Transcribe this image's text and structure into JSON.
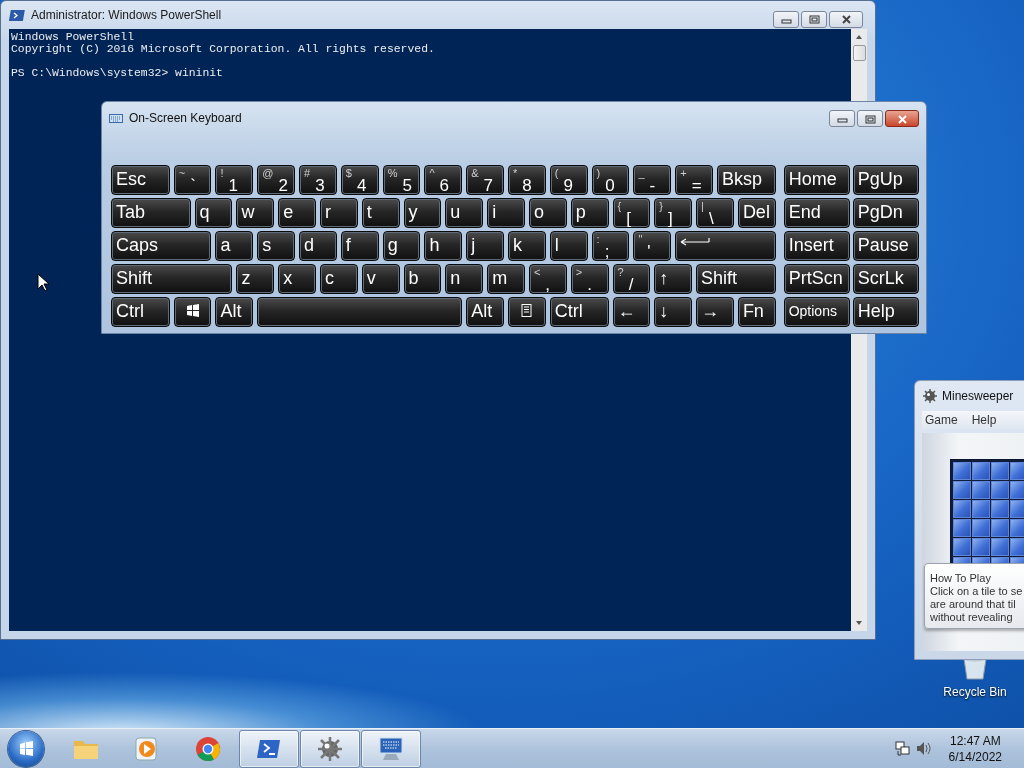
{
  "powershell": {
    "title": "Administrator: Windows PowerShell",
    "lines": [
      "Windows PowerShell",
      "Copyright (C) 2016 Microsoft Corporation. All rights reserved."
    ],
    "prompt": "PS C:\\Windows\\system32> wininit"
  },
  "keyboard": {
    "title": "On-Screen Keyboard",
    "key_rows": [
      {
        "keys": [
          {
            "kind": "label",
            "label": "Esc"
          },
          {
            "kind": "dual",
            "shift": "~",
            "label": "`"
          },
          {
            "kind": "dual",
            "shift": "!",
            "label": "1"
          },
          {
            "kind": "dual",
            "shift": "@",
            "label": "2"
          },
          {
            "kind": "dual",
            "shift": "#",
            "label": "3"
          },
          {
            "kind": "dual",
            "shift": "$",
            "label": "4"
          },
          {
            "kind": "dual",
            "shift": "%",
            "label": "5"
          },
          {
            "kind": "dual",
            "shift": "^",
            "label": "6"
          },
          {
            "kind": "dual",
            "shift": "&",
            "label": "7"
          },
          {
            "kind": "dual",
            "shift": "*",
            "label": "8"
          },
          {
            "kind": "dual",
            "shift": "(",
            "label": "9"
          },
          {
            "kind": "dual",
            "shift": ")",
            "label": "0"
          },
          {
            "kind": "dual",
            "shift": "_",
            "label": "-"
          },
          {
            "kind": "dual",
            "shift": "+",
            "label": "="
          },
          {
            "kind": "label",
            "label": "Bksp"
          }
        ]
      },
      {
        "keys": [
          {
            "kind": "label",
            "label": "Tab"
          },
          {
            "kind": "label",
            "label": "q"
          },
          {
            "kind": "label",
            "label": "w"
          },
          {
            "kind": "label",
            "label": "e"
          },
          {
            "kind": "label",
            "label": "r"
          },
          {
            "kind": "label",
            "label": "t"
          },
          {
            "kind": "label",
            "label": "y"
          },
          {
            "kind": "label",
            "label": "u"
          },
          {
            "kind": "label",
            "label": "i"
          },
          {
            "kind": "label",
            "label": "o"
          },
          {
            "kind": "label",
            "label": "p"
          },
          {
            "kind": "dual",
            "shift": "{",
            "label": "["
          },
          {
            "kind": "dual",
            "shift": "}",
            "label": "]"
          },
          {
            "kind": "dual",
            "shift": "|",
            "label": "\\"
          },
          {
            "kind": "label",
            "label": "Del"
          }
        ]
      },
      {
        "keys": [
          {
            "kind": "label",
            "label": "Caps"
          },
          {
            "kind": "label",
            "label": "a"
          },
          {
            "kind": "label",
            "label": "s"
          },
          {
            "kind": "label",
            "label": "d"
          },
          {
            "kind": "label",
            "label": "f"
          },
          {
            "kind": "label",
            "label": "g"
          },
          {
            "kind": "label",
            "label": "h"
          },
          {
            "kind": "label",
            "label": "j"
          },
          {
            "kind": "label",
            "label": "k"
          },
          {
            "kind": "label",
            "label": "l"
          },
          {
            "kind": "dual",
            "shift": ":",
            "label": ";"
          },
          {
            "kind": "dual",
            "shift": "\"",
            "label": "'"
          },
          {
            "kind": "enter"
          }
        ]
      },
      {
        "keys": [
          {
            "kind": "label",
            "label": "Shift"
          },
          {
            "kind": "label",
            "label": "z"
          },
          {
            "kind": "label",
            "label": "x"
          },
          {
            "kind": "label",
            "label": "c"
          },
          {
            "kind": "label",
            "label": "v"
          },
          {
            "kind": "label",
            "label": "b"
          },
          {
            "kind": "label",
            "label": "n"
          },
          {
            "kind": "label",
            "label": "m"
          },
          {
            "kind": "dual",
            "shift": "<",
            "label": ","
          },
          {
            "kind": "dual",
            "shift": ">",
            "label": "."
          },
          {
            "kind": "dual",
            "shift": "?",
            "label": "/"
          },
          {
            "kind": "arrow",
            "label": "↑"
          },
          {
            "kind": "label",
            "label": "Shift"
          }
        ]
      },
      {
        "keys": [
          {
            "kind": "label",
            "label": "Ctrl"
          },
          {
            "kind": "windows"
          },
          {
            "kind": "label",
            "label": "Alt"
          },
          {
            "kind": "space"
          },
          {
            "kind": "label",
            "label": "Alt"
          },
          {
            "kind": "menu"
          },
          {
            "kind": "label",
            "label": "Ctrl"
          },
          {
            "kind": "arrow",
            "label": "←"
          },
          {
            "kind": "arrow",
            "label": "↓"
          },
          {
            "kind": "arrow",
            "label": "→"
          },
          {
            "kind": "label",
            "label": "Fn"
          }
        ]
      }
    ],
    "side_keys": [
      "Home",
      "PgUp",
      "End",
      "PgDn",
      "Insert",
      "Pause",
      "PrtScn",
      "ScrLk",
      "Options",
      "Help"
    ]
  },
  "minesweeper": {
    "title": "Minesweeper",
    "menu": [
      "Game",
      "Help"
    ],
    "tooltip": {
      "title": "How To Play",
      "lines": [
        "Click on a tile to se",
        "are around that til",
        "without revealing"
      ]
    }
  },
  "desktop_icons": [
    {
      "label": "Recycle Bin"
    }
  ],
  "taskbar": {
    "items": [
      {
        "kind": "folder",
        "open": false
      },
      {
        "kind": "media",
        "open": false
      },
      {
        "kind": "browser",
        "open": false
      },
      {
        "kind": "terminal",
        "open": true
      },
      {
        "kind": "mine",
        "open": true
      },
      {
        "kind": "keyboard",
        "open": true
      }
    ],
    "time": "12:47 AM",
    "date": "6/14/2022"
  }
}
